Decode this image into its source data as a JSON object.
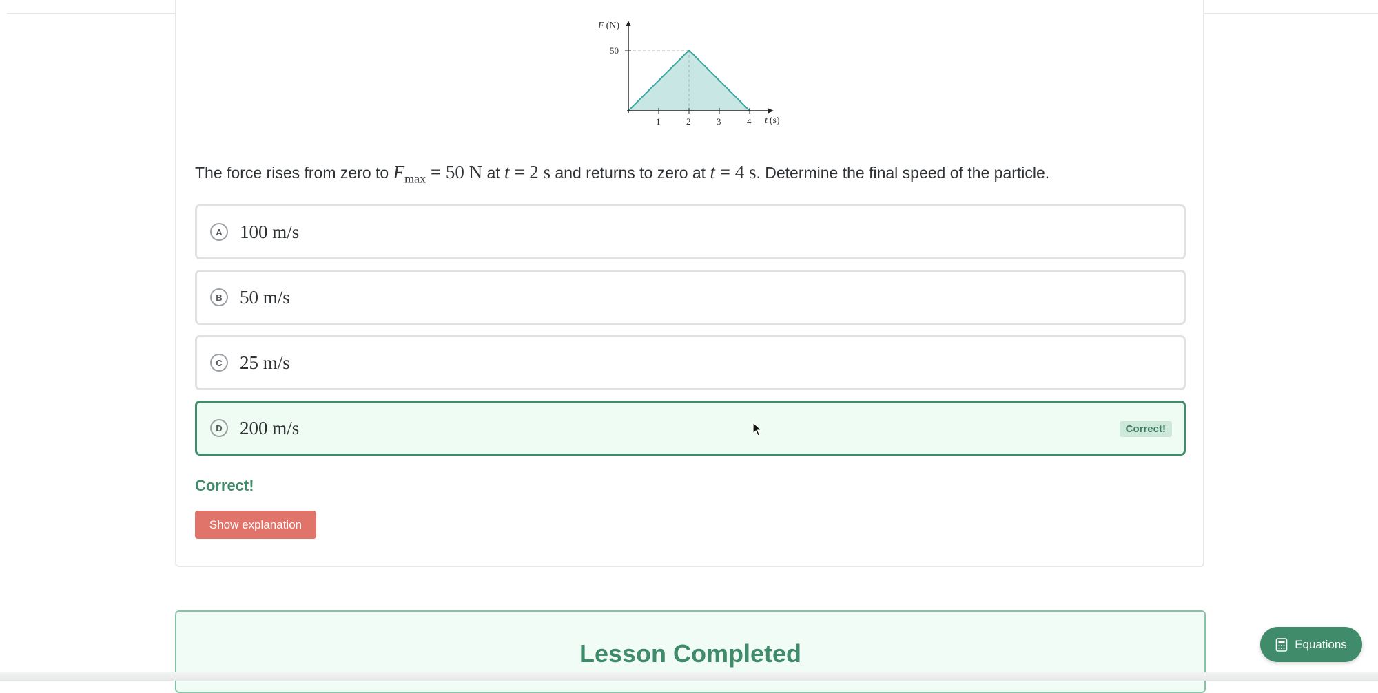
{
  "colors": {
    "accent_green": "#3f8b6a",
    "correct_bg": "#effcf3",
    "button_red": "#e0736a",
    "graph_fill": "#c8e6e3",
    "graph_line": "#3aa6a0"
  },
  "graph": {
    "y_label_var": "F",
    "y_label_unit": "(N)",
    "x_label_var": "t",
    "x_label_unit": "(s)",
    "y_tick": "50",
    "x_ticks": [
      "1",
      "2",
      "3",
      "4"
    ]
  },
  "chart_data": {
    "type": "area",
    "x": [
      0,
      2,
      4
    ],
    "y": [
      0,
      50,
      0
    ],
    "xlabel": "t (s)",
    "ylabel": "F (N)",
    "xticks": [
      1,
      2,
      3,
      4
    ],
    "yticks": [
      50
    ],
    "xlim": [
      0,
      4.5
    ],
    "ylim": [
      0,
      55
    ]
  },
  "question": {
    "part1": "The force rises from zero to ",
    "fmax_var": "F",
    "fmax_sub": "max",
    "fmax_val": " = 50 N",
    "part2": " at ",
    "t1_var": "t",
    "t1_val": " = 2 s",
    "part3": " and returns to zero at ",
    "t2_var": "t",
    "t2_val": " = 4 s",
    "part4": ". Determine the final speed of the particle."
  },
  "options": [
    {
      "letter": "A",
      "value": "100 m/s"
    },
    {
      "letter": "B",
      "value": "50 m/s"
    },
    {
      "letter": "C",
      "value": "25 m/s"
    },
    {
      "letter": "D",
      "value": "200 m/s",
      "badge": "Correct!"
    }
  ],
  "feedback": "Correct!",
  "show_explanation_label": "Show explanation",
  "lesson_completed_label": "Lesson Completed",
  "equations_label": "Equations",
  "icons": {
    "equations": "calculator-icon",
    "cursor": "mouse-pointer-icon"
  }
}
